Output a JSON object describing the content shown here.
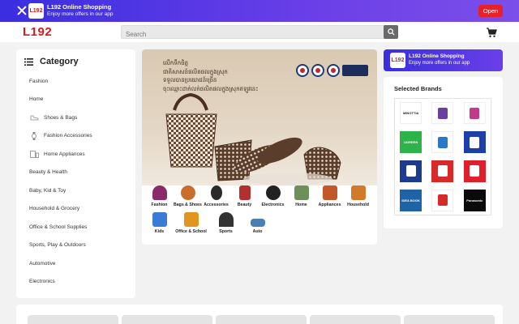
{
  "app_banner": {
    "logo_text": "L192",
    "title": "L192 Online Shopping",
    "subtitle": "Enjoy more offers in our app",
    "open_label": "Open"
  },
  "header": {
    "brand": "L192",
    "search_placeholder": "Search",
    "icons": [
      "search-icon",
      "cart-icon",
      "close-icon",
      "menu-icon"
    ]
  },
  "category": {
    "title": "Category",
    "items": [
      {
        "label": "Fashion",
        "icon": ""
      },
      {
        "label": "Home",
        "icon": ""
      },
      {
        "label": "Shoes & Bags",
        "icon": "shoe-icon"
      },
      {
        "label": "Fashion Accessories",
        "icon": "watch-icon"
      },
      {
        "label": "Home Appliances",
        "icon": "appliance-icon"
      },
      {
        "label": "Beauty & Health",
        "icon": ""
      },
      {
        "label": "Baby, Kid & Toy",
        "icon": ""
      },
      {
        "label": "Household & Grocery",
        "icon": ""
      },
      {
        "label": "Office & School Supplies",
        "icon": ""
      },
      {
        "label": "Sports, Play & Outdoors",
        "icon": ""
      },
      {
        "label": "Automotive",
        "icon": ""
      },
      {
        "label": "Electronics",
        "icon": ""
      }
    ]
  },
  "hero": {
    "headline_lines": [
      "លើកទឹកចិត្ត",
      "ជាតិសាសន៍ផលិតផលក្នុងស្រុក",
      "ទទួលបានប្រយោជន៍ច្រើន",
      "ចុះឈ្មោះដាក់លក់ផលិតផលក្នុងស្រុកឥឡូវនេះ"
    ],
    "mini_categories_row1": [
      "Fashion",
      "Bags & Shoes",
      "Accessories",
      "Beauty",
      "Electronics",
      "Home",
      "Appliances",
      "Household"
    ],
    "mini_categories_row2": [
      "Kids",
      "Office & School",
      "Sports",
      "Auto"
    ]
  },
  "promo": {
    "logo_text": "L192",
    "title": "L192 Online Shopping",
    "subtitle": "Enjoy more offers in our app"
  },
  "brands": {
    "title": "Selected Brands",
    "items": [
      {
        "name": "MINOTTIA",
        "bg": "#ffffff",
        "fg": "#222222"
      },
      {
        "name": "",
        "bg": "#ffffff",
        "fg": "#6a3fa0"
      },
      {
        "name": "",
        "bg": "#ffffff",
        "fg": "#c23a8a"
      },
      {
        "name": "UGREEN",
        "bg": "#2cb34a",
        "fg": "#ffffff"
      },
      {
        "name": "",
        "bg": "#ffffff",
        "fg": "#2a78c8"
      },
      {
        "name": "",
        "bg": "#1d3fa8",
        "fg": "#ffffff"
      },
      {
        "name": "",
        "bg": "#1d3b8f",
        "fg": "#ffffff"
      },
      {
        "name": "",
        "bg": "#d92a2a",
        "fg": "#ffffff"
      },
      {
        "name": "",
        "bg": "#e01f2d",
        "fg": "#ffffff"
      },
      {
        "name": "IDEA BOOK",
        "bg": "#1e63a8",
        "fg": "#ffffff"
      },
      {
        "name": "",
        "bg": "#ffffff",
        "fg": "#d92a2a"
      },
      {
        "name": "Panasonic",
        "bg": "#0a0a0a",
        "fg": "#ffffff"
      }
    ]
  },
  "colors": {
    "brand_red": "#d71920",
    "banner_purple": "#5b35e6",
    "open_red": "#e8202a"
  }
}
